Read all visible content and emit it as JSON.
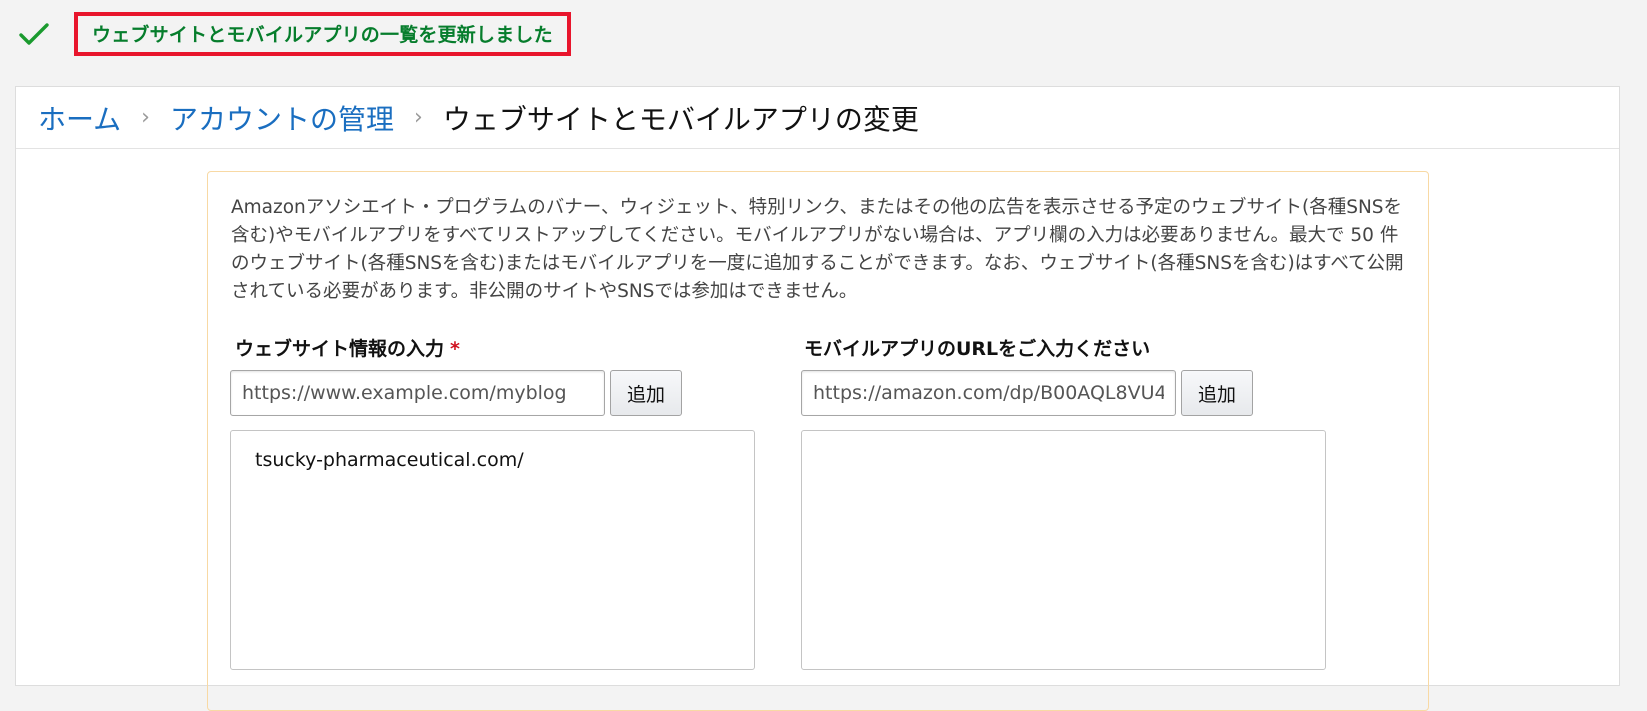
{
  "alert": {
    "icon": "check-icon",
    "message": "ウェブサイトとモバイルアプリの一覧を更新しました",
    "icon_color": "#067d2c",
    "border_color": "#e8152c"
  },
  "breadcrumb": {
    "home": "ホーム",
    "account": "アカウントの管理",
    "current": "ウェブサイトとモバイルアプリの変更"
  },
  "intro_text": "Amazonアソシエイト・プログラムのバナー、ウィジェット、特別リンク、またはその他の広告を表示させる予定のウェブサイト(各種SNSを含む)やモバイルアプリをすべてリストアップしてください。モバイルアプリがない場合は、アプリ欄の入力は必要ありません。最大で 50 件のウェブサイト(各種SNSを含む)またはモバイルアプリを一度に追加することができます。なお、ウェブサイト(各種SNSを含む)はすべて公開されている必要があります。非公開のサイトやSNSでは参加はできません。",
  "website": {
    "label": "ウェブサイト情報の入力",
    "required_mark": "*",
    "placeholder": "https://www.example.com/myblog",
    "add_label": "追加",
    "items": [
      "tsucky-pharmaceutical.com/"
    ]
  },
  "app": {
    "label": "モバイルアプリのURLをご入力ください",
    "placeholder": "https://amazon.com/dp/B00AQL8VU4",
    "add_label": "追加",
    "items": []
  }
}
